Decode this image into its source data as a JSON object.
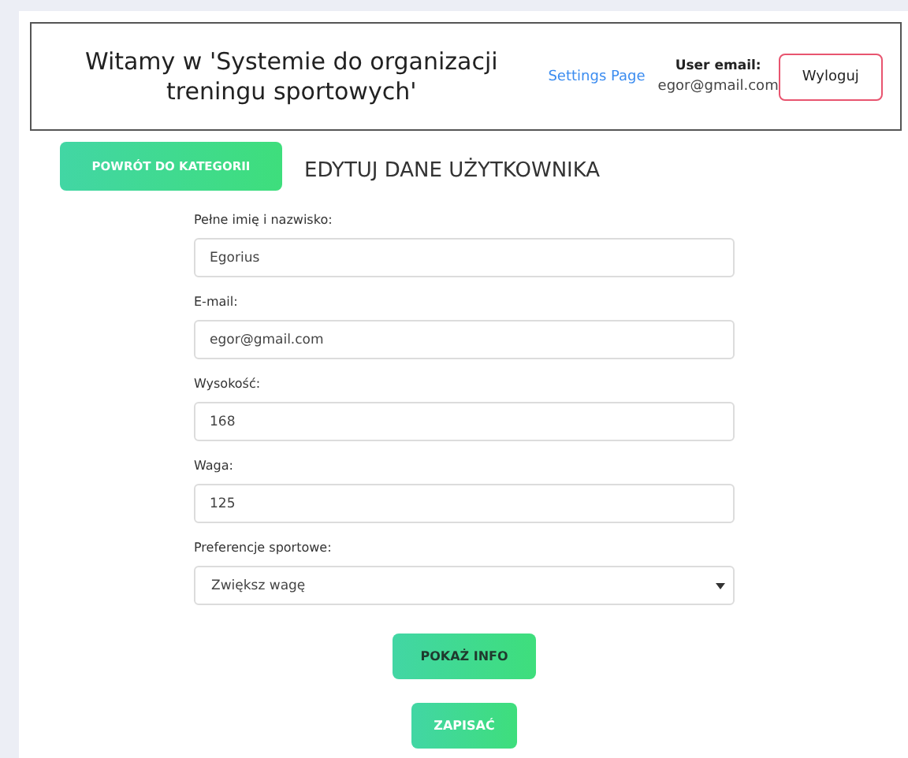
{
  "header": {
    "title": "Witamy w 'Systemie do organizacji treningu sportowych'",
    "settings_link": "Settings Page",
    "user_email_label": "User email:",
    "user_email": "egor@gmail.com",
    "logout_button": "Wyloguj"
  },
  "back_button": "POWRÓT DO KATEGORII",
  "heading": "EDYTUJ DANE UŻYTKOWNIKA",
  "fields": [
    {
      "kind": "input",
      "label": "Pełne imię i nazwisko:",
      "value": "Egorius"
    },
    {
      "kind": "input",
      "label": "E-mail:",
      "value": "egor@gmail.com"
    },
    {
      "kind": "input",
      "label": "Wysokość:",
      "value": "168"
    },
    {
      "kind": "input",
      "label": "Waga:",
      "value": "125"
    },
    {
      "kind": "select",
      "label": "Preferencje sportowe:",
      "value": "Zwiększ wagę"
    }
  ],
  "buttons": [
    {
      "kind": "info",
      "label": "POKAŻ INFO"
    },
    {
      "kind": "submit",
      "label": "ZAPISAĆ"
    }
  ]
}
